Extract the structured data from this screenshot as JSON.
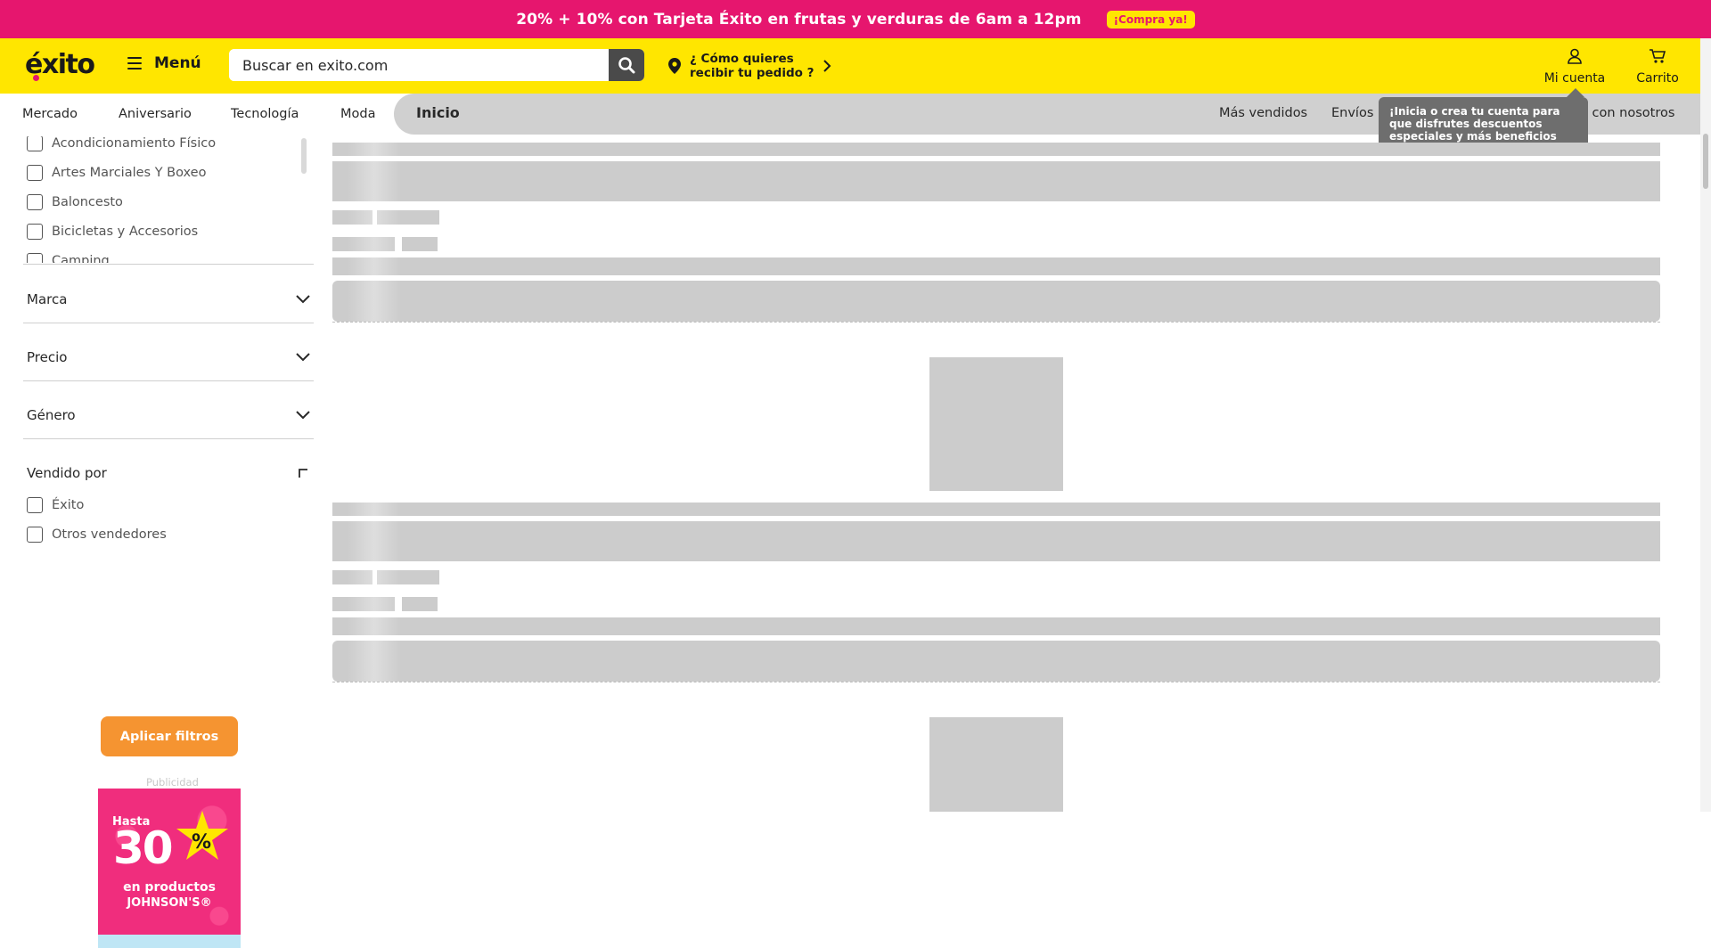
{
  "promo": {
    "text": "20% + 10% con Tarjeta Éxito en frutas y verduras de 6am a 12pm",
    "cta": "¡Compra ya!"
  },
  "header": {
    "logo": "éxito",
    "menu_label": "Menú",
    "search_placeholder": "Buscar en exito.com",
    "delivery_line1": "¿ Cómo quieres",
    "delivery_line2": "recibir tu pedido ?",
    "account_label": "Mi cuenta",
    "cart_label": "Carrito"
  },
  "nav": {
    "categories": [
      "Mercado",
      "Aniversario",
      "Tecnología",
      "Moda"
    ],
    "breadcrumb": "Inicio",
    "right_links": [
      "Más vendidos",
      "Envíos 2",
      "e con nosotros"
    ]
  },
  "tooltip": {
    "prefix": "¡Inicia o crea tu cuenta para que disfrutes ",
    "bold": "descuentos especiales y más beneficios para ti!"
  },
  "filters": {
    "category_options": [
      "Acondicionamiento Físico",
      "Artes Marciales Y Boxeo",
      "Baloncesto",
      "Bicicletas y Accesorios",
      "Camping"
    ],
    "facets": [
      "Marca",
      "Precio",
      "Género"
    ],
    "sold_by": {
      "title": "Vendido por",
      "options": [
        "Éxito",
        "Otros vendedores"
      ]
    },
    "apply_label": "Aplicar filtros"
  },
  "ad": {
    "label": "Publicidad",
    "hasta": "Hasta",
    "value": "30",
    "percent": "%",
    "line1": "en productos",
    "line2": "JOHNSON'S®"
  },
  "colors": {
    "promo": "#e6166e",
    "header": "#ffe600",
    "apply_button": "#f59431",
    "skeleton": "#cccccc"
  }
}
